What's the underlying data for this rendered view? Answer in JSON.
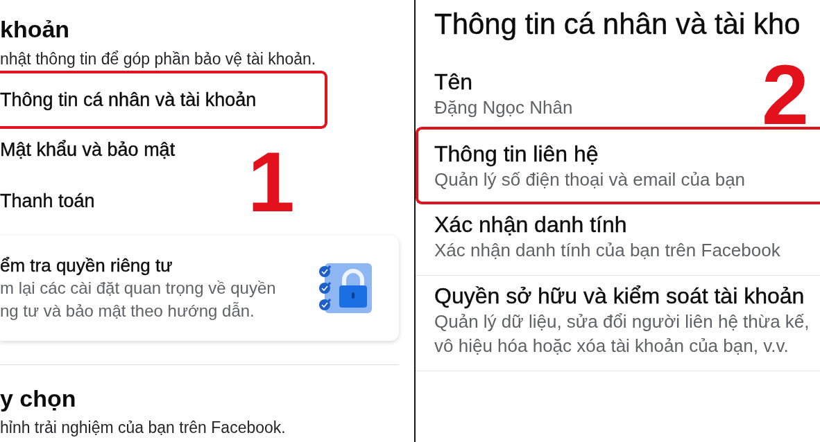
{
  "left_screen": {
    "title": "khoản",
    "subtitle": "nhật thông tin để góp phần bảo vệ tài khoản.",
    "menu_items": [
      {
        "label": "Thông tin cá nhân và tài khoản",
        "highlighted": true
      },
      {
        "label": "Mật khẩu và bảo mật",
        "highlighted": false
      },
      {
        "label": "Thanh toán",
        "highlighted": false
      }
    ],
    "step_number": "1",
    "privacy_card": {
      "title": "ểm tra quyền riêng tư",
      "description": "m lại các cài đặt quan trọng về quyền\nng tư và bảo mật theo hướng dẫn."
    },
    "preferences": {
      "title": "y chọn",
      "subtitle": "hỉnh trải nghiệm của bạn trên Facebook."
    }
  },
  "right_screen": {
    "title": "Thông tin cá nhân và tài kho",
    "step_number": "2",
    "items": [
      {
        "title": "Tên",
        "subtitle": "Đặng Ngọc Nhân",
        "highlighted": false
      },
      {
        "title": "Thông tin liên hệ",
        "subtitle": "Quản lý số điện thoại và email của bạn",
        "highlighted": true
      },
      {
        "title": "Xác nhận danh tính",
        "subtitle": "Xác nhận danh tính của bạn trên Facebook",
        "highlighted": false
      },
      {
        "title": "Quyền sở hữu và kiểm soát tài khoản",
        "subtitle": "Quản lý dữ liệu, sửa đổi người liên hệ thừa kế,\nvô hiệu hóa hoặc xóa tài khoản của bạn, v.v.",
        "highlighted": false
      }
    ]
  }
}
